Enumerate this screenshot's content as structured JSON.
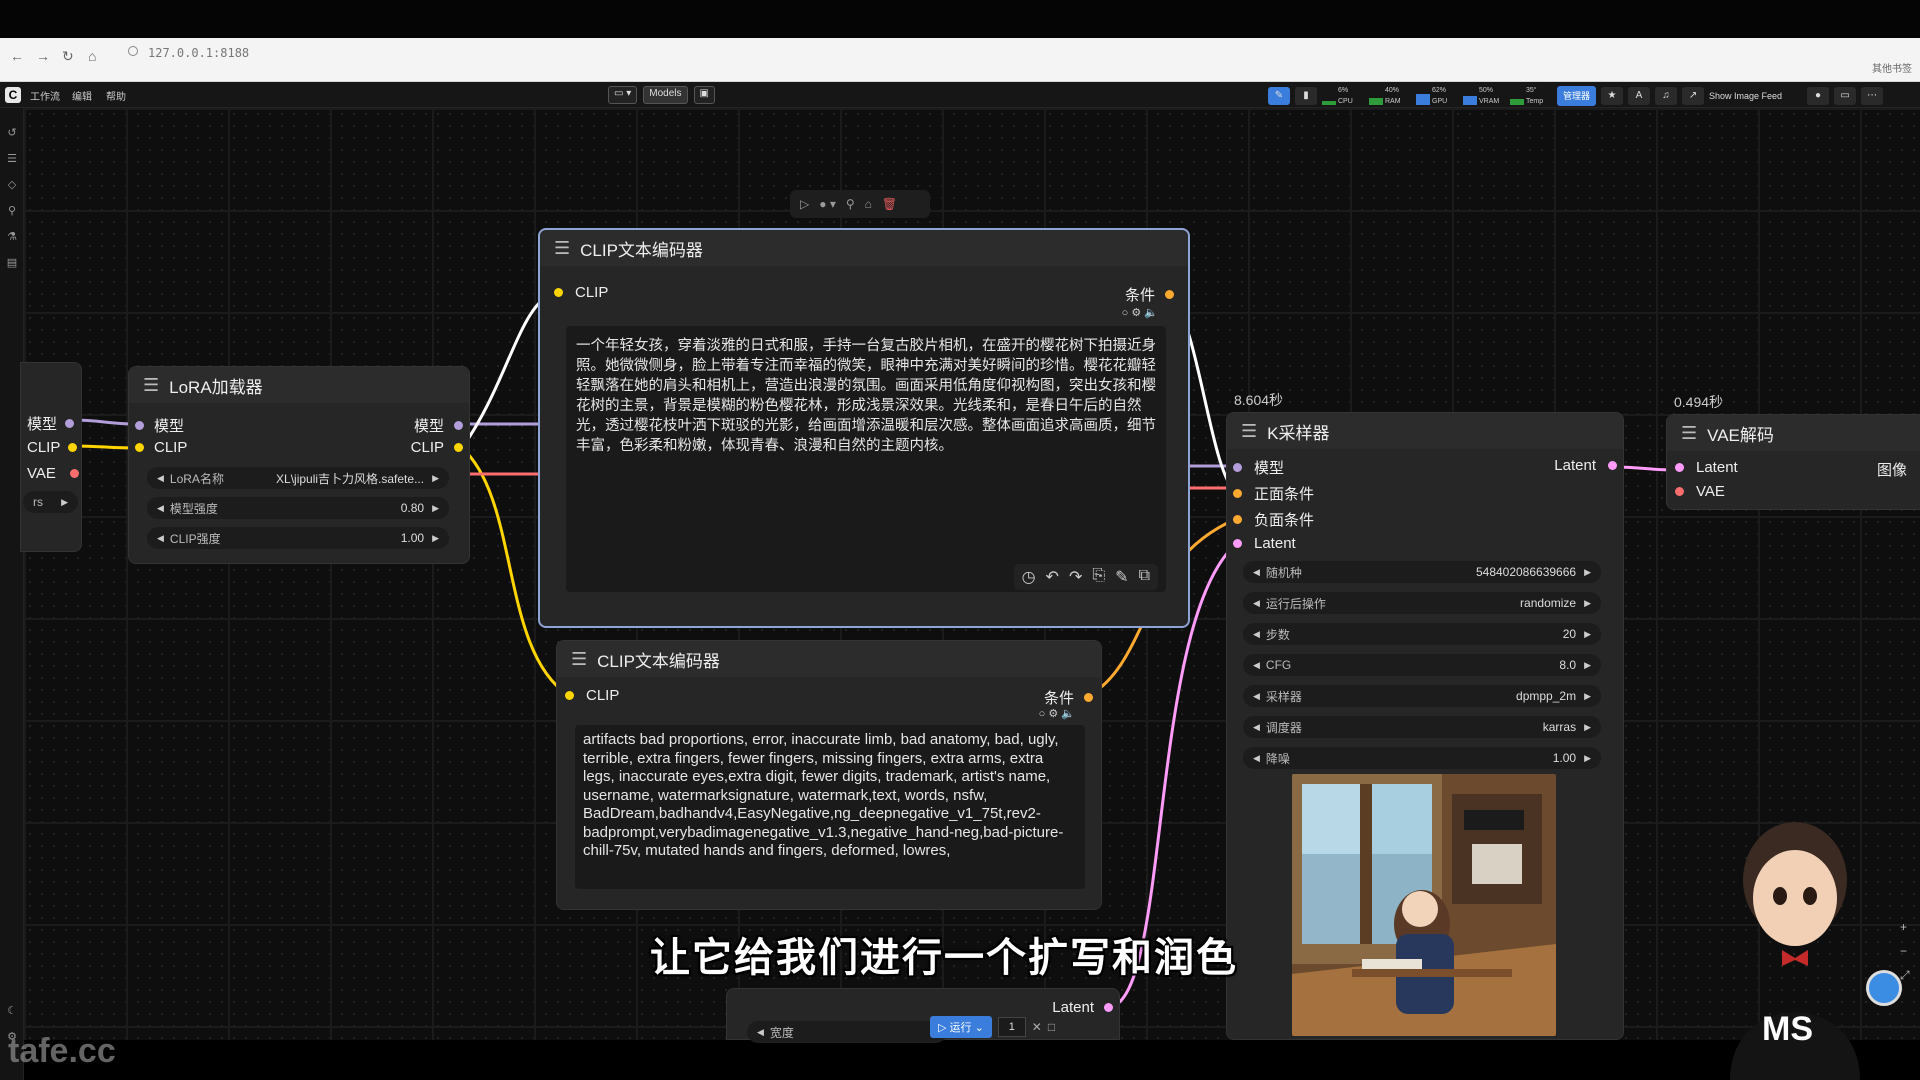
{
  "browser": {
    "url": "127.0.0.1:8188",
    "bookmarks_right": "其他书签"
  },
  "menubar": {
    "items": [
      "工作流",
      "编辑",
      "帮助"
    ],
    "models_label": "Models",
    "meters": [
      {
        "label": "CPU",
        "pct": "6%"
      },
      {
        "label": "RAM",
        "pct": "40%"
      },
      {
        "label": "GPU",
        "pct": "62%"
      },
      {
        "label": "VRAM",
        "pct": "50%"
      },
      {
        "label": "Temp",
        "pct": "35°"
      }
    ],
    "manager_label": "管理器",
    "show_feed_label": "Show Image Feed"
  },
  "lora_node": {
    "title": "LoRA加载器",
    "in_model": "模型",
    "in_clip": "CLIP",
    "out_model": "模型",
    "out_clip": "CLIP",
    "widgets": [
      {
        "label": "LoRA名称",
        "value": "XL\\jipuli吉卜力风格.safete..."
      },
      {
        "label": "模型强度",
        "value": "0.80"
      },
      {
        "label": "CLIP强度",
        "value": "1.00"
      }
    ]
  },
  "left_partial_node": {
    "out1": "模型",
    "out2": "CLIP",
    "out3": "VAE",
    "widget": "rs"
  },
  "clip_pos_node": {
    "title": "CLIP文本编码器",
    "in_clip": "CLIP",
    "out": "条件",
    "text": "一个年轻女孩，穿着淡雅的日式和服，手持一台复古胶片相机，在盛开的樱花树下拍摄近身照。她微微侧身，脸上带着专注而幸福的微笑，眼神中充满对美好瞬间的珍惜。樱花花瓣轻轻飘落在她的肩头和相机上，营造出浪漫的氛围。画面采用低角度仰视构图，突出女孩和樱花树的主景，背景是模糊的粉色樱花林，形成浅景深效果。光线柔和，是春日午后的自然光，透过樱花枝叶洒下斑驳的光影，给画面增添温暖和层次感。整体画面追求高画质，细节丰富，色彩柔和粉嫩，体现青春、浪漫和自然的主题内核。"
  },
  "clip_neg_node": {
    "title": "CLIP文本编码器",
    "in_clip": "CLIP",
    "out": "条件",
    "text": "artifacts bad proportions, error, inaccurate limb, bad anatomy, bad, ugly, terrible, extra fingers, fewer fingers, missing fingers, extra arms, extra legs, inaccurate eyes,extra digit, fewer digits, trademark, artist's name, username, watermarksignature, watermark,text, words, nsfw, BadDream,badhandv4,EasyNegative,ng_deepnegative_v1_75t,rev2-badprompt,verybadimagenegative_v1.3,negative_hand-neg,bad-picture-chill-75v, mutated hands and fingers, deformed, lowres,"
  },
  "ksampler_node": {
    "title": "K采样器",
    "timing": "8.604秒",
    "in_model": "模型",
    "in_pos": "正面条件",
    "in_neg": "负面条件",
    "in_latent": "Latent",
    "out_latent": "Latent",
    "widgets": [
      {
        "label": "随机种",
        "value": "548402086639666"
      },
      {
        "label": "运行后操作",
        "value": "randomize"
      },
      {
        "label": "步数",
        "value": "20"
      },
      {
        "label": "CFG",
        "value": "8.0"
      },
      {
        "label": "采样器",
        "value": "dpmpp_2m"
      },
      {
        "label": "调度器",
        "value": "karras"
      },
      {
        "label": "降噪",
        "value": "1.00"
      }
    ]
  },
  "vae_node": {
    "title": "VAE解码",
    "timing": "0.494秒",
    "in_latent": "Latent",
    "in_vae": "VAE",
    "out_image": "图像"
  },
  "bottom_node": {
    "out_latent": "Latent",
    "widget_label": "宽度"
  },
  "runbar": {
    "run_label": "运行",
    "count": "1"
  },
  "subtitle": "让它给我们进行一个扩写和润色",
  "watermark": "tafe.cc",
  "avatar_text": "MS",
  "colors": {
    "model": "#b39ddb",
    "clip": "#ffd500",
    "vae": "#ff6e6e",
    "cond": "#ffa931",
    "latent": "#ff9cf9",
    "accent": "#3b7ddd"
  }
}
